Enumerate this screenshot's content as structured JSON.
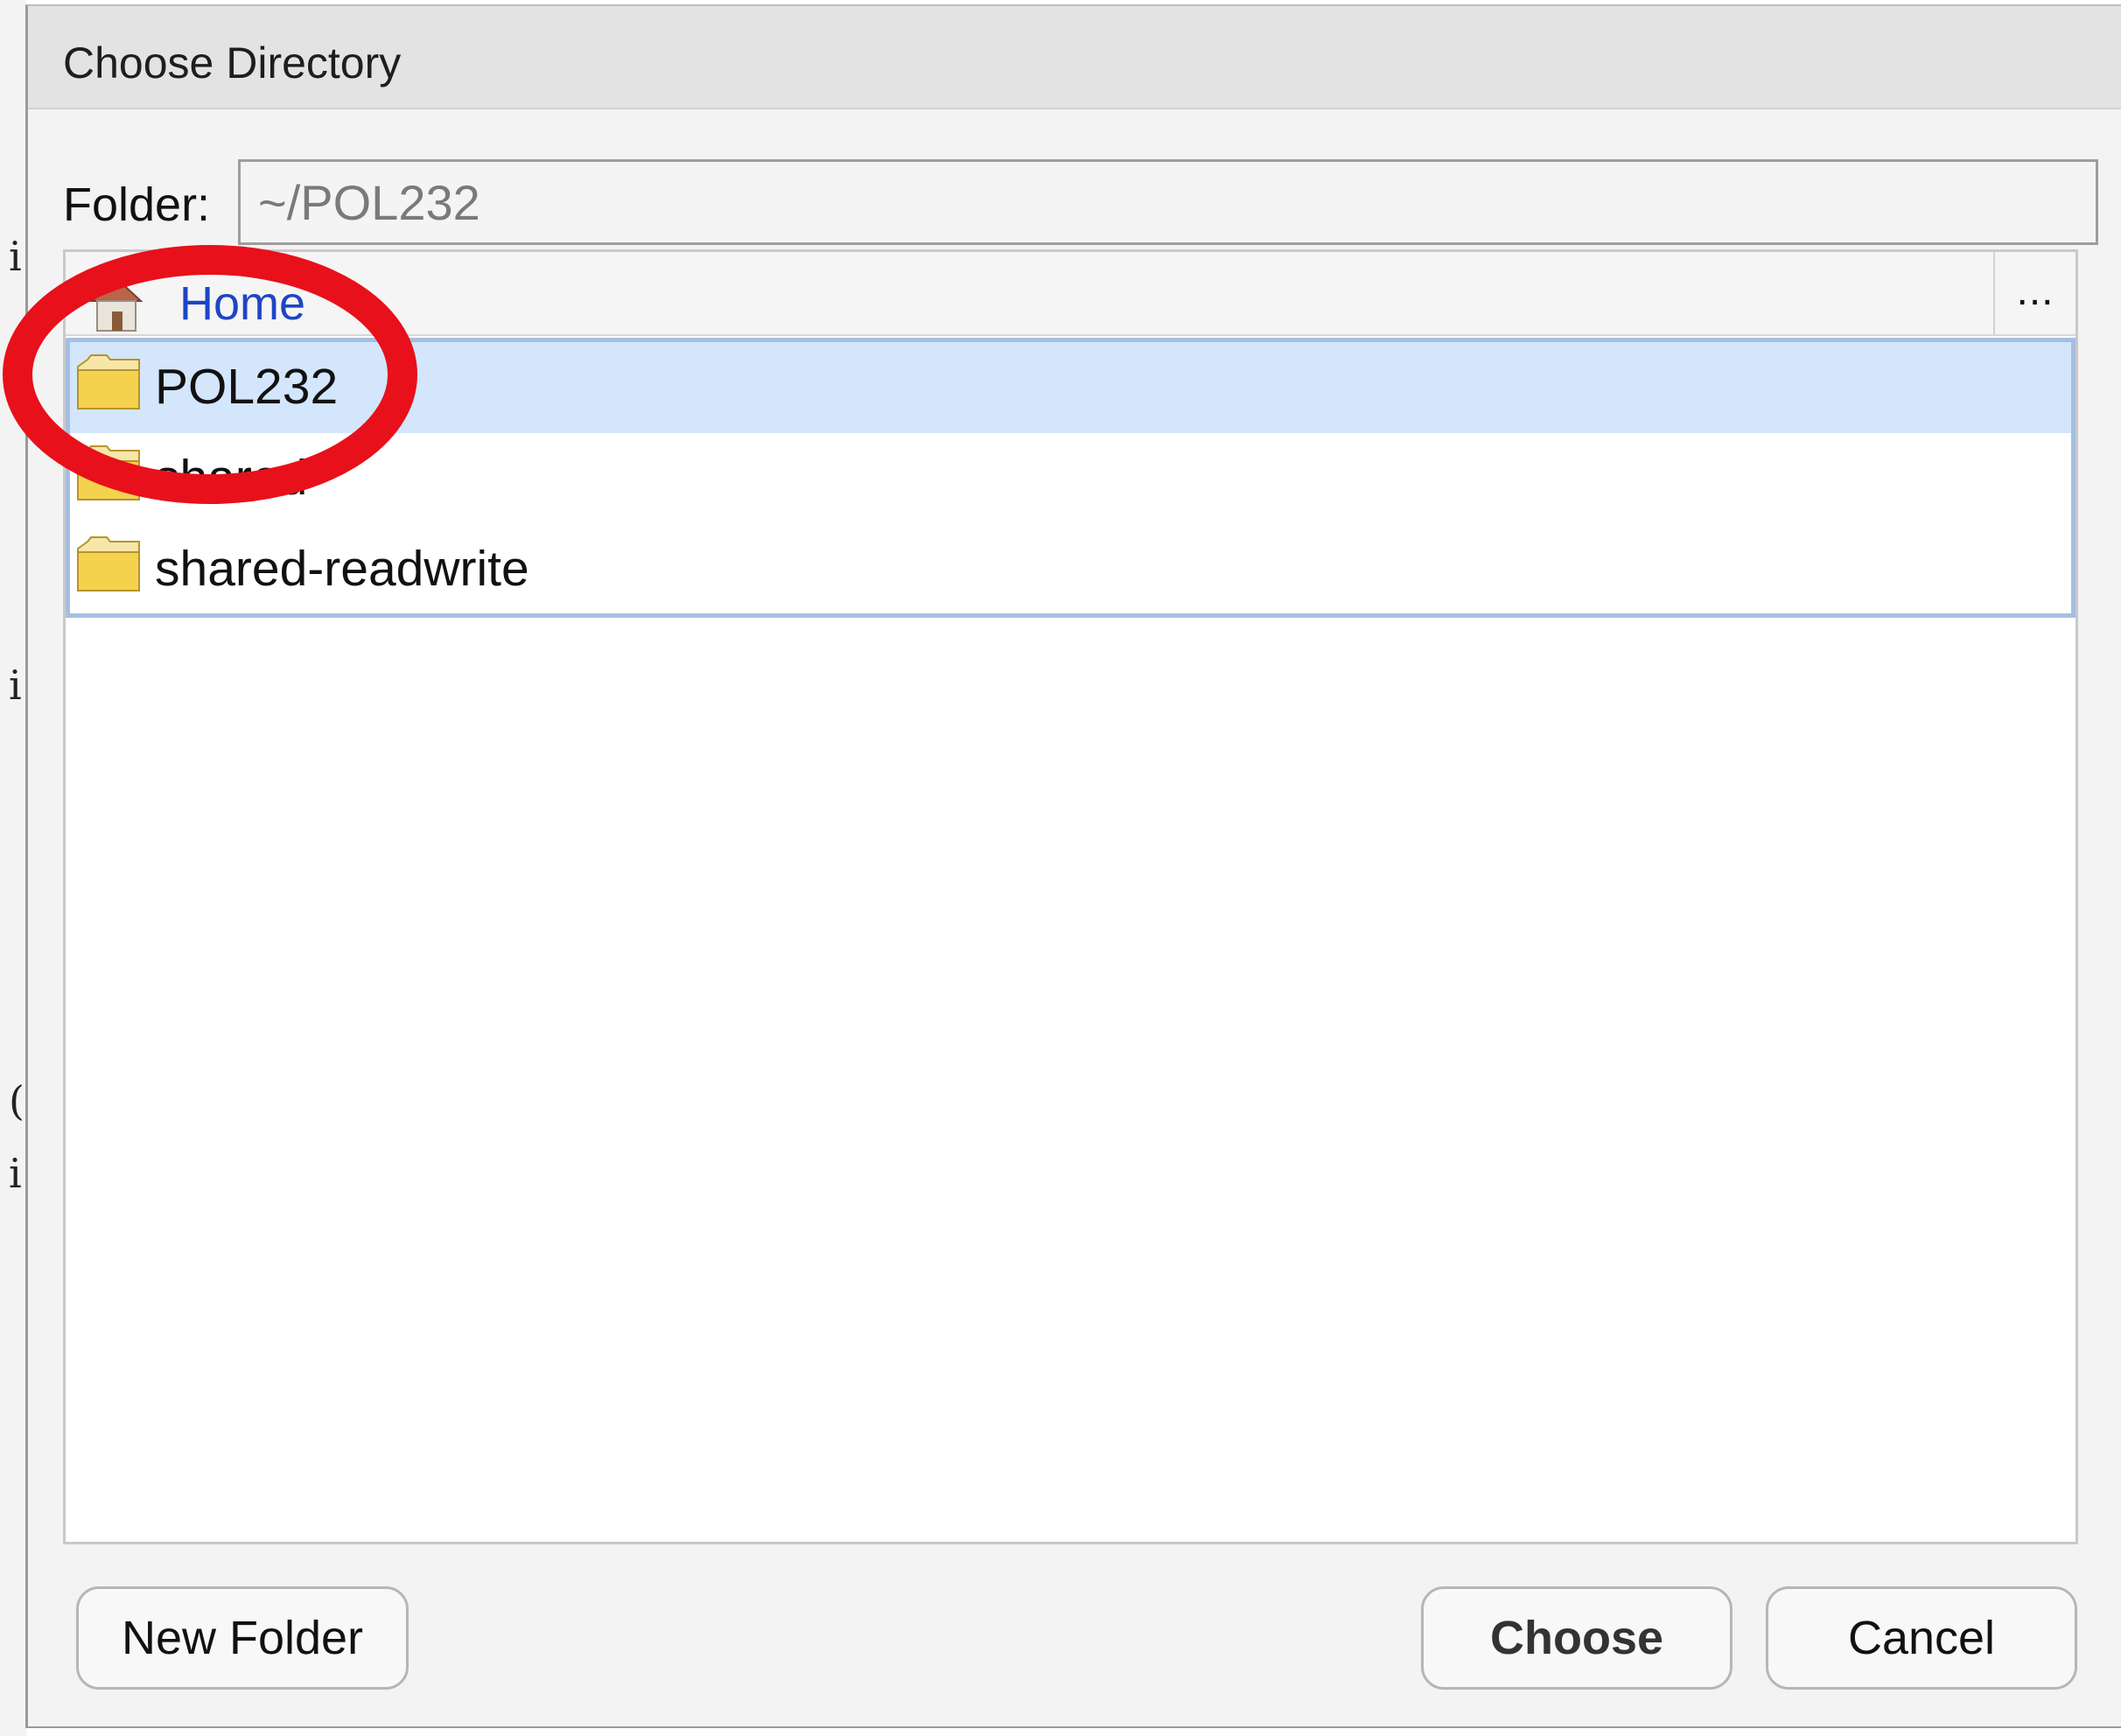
{
  "dialog": {
    "title": "Choose Directory",
    "folder_label": "Folder:",
    "folder_value": "~/POL232"
  },
  "breadcrumb": {
    "home_label": "Home",
    "more_label": "..."
  },
  "folders": [
    {
      "name": "POL232",
      "selected": true
    },
    {
      "name": "shared",
      "selected": false
    },
    {
      "name": "shared-readwrite",
      "selected": false
    }
  ],
  "buttons": {
    "new_folder": "New Folder",
    "choose": "Choose",
    "cancel": "Cancel"
  },
  "background_glyphs": [
    "i",
    "i",
    "(",
    "i"
  ],
  "colors": {
    "annotation_circle": "#e8101a",
    "selection": "#d3e6fb",
    "link": "#1f45c4",
    "folder_icon": "#f5d24e"
  }
}
